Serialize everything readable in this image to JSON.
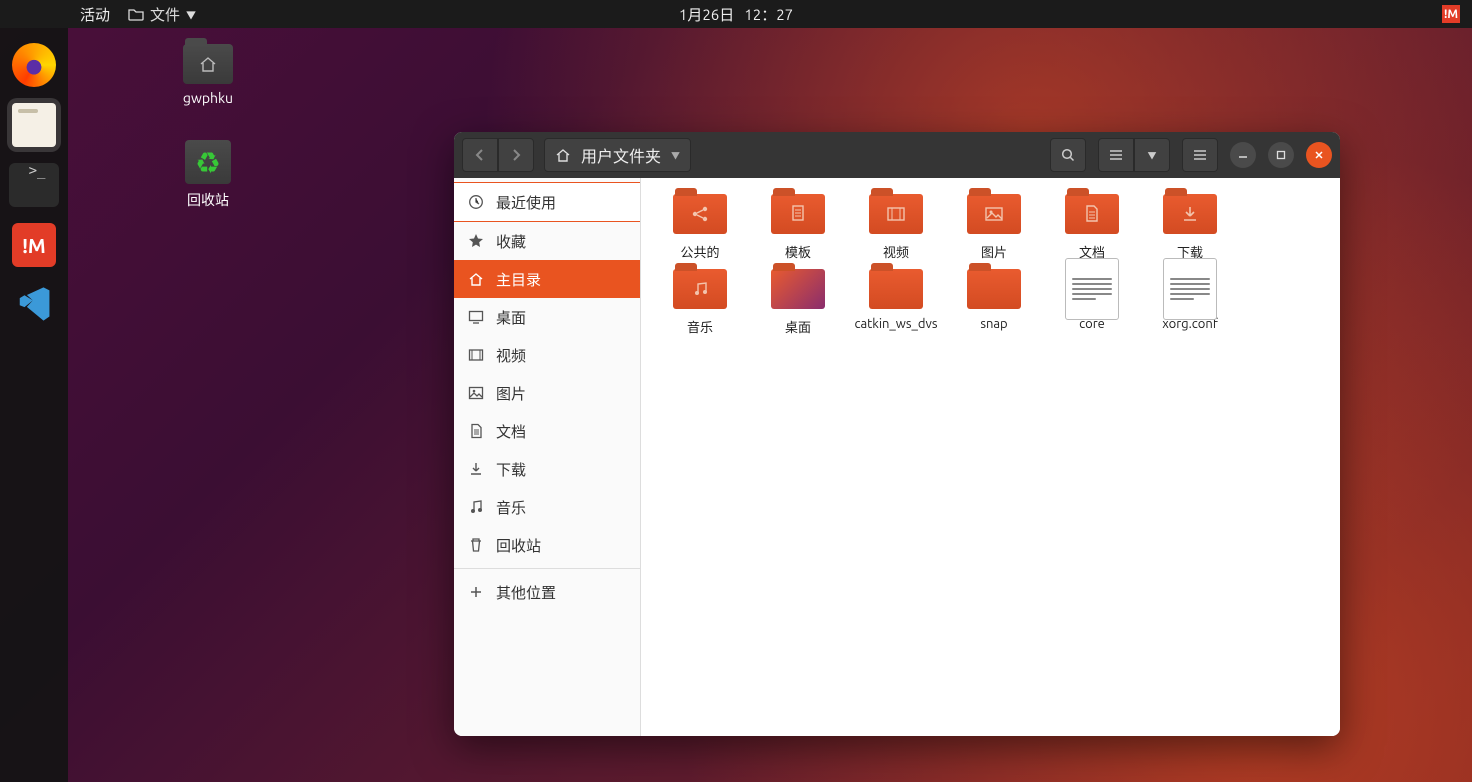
{
  "top": {
    "activities": "活动",
    "app_label": "文件",
    "date": "1月26日",
    "time": "12：27"
  },
  "dock": {
    "items": [
      "firefox",
      "files",
      "terminal",
      "nomachine",
      "vscode"
    ]
  },
  "desktop": {
    "home_folder": "gwphku",
    "trash": "回收站"
  },
  "fm": {
    "path_label": "用户文件夹",
    "sidebar": {
      "recent": "最近使用",
      "starred": "收藏",
      "home": "主目录",
      "desktop": "桌面",
      "videos": "视频",
      "pictures": "图片",
      "documents": "文档",
      "downloads": "下载",
      "music": "音乐",
      "trash": "回收站",
      "other": "其他位置"
    },
    "content": [
      {
        "label": "公共的",
        "type": "share"
      },
      {
        "label": "模板",
        "type": "templates"
      },
      {
        "label": "视频",
        "type": "videos"
      },
      {
        "label": "图片",
        "type": "pictures"
      },
      {
        "label": "文档",
        "type": "documents"
      },
      {
        "label": "下载",
        "type": "downloads"
      },
      {
        "label": "音乐",
        "type": "music"
      },
      {
        "label": "桌面",
        "type": "desktop-gradient"
      },
      {
        "label": "catkin_ws_dvs",
        "type": "plain"
      },
      {
        "label": "snap",
        "type": "plain"
      },
      {
        "label": "core",
        "type": "textfile"
      },
      {
        "label": "xorg.conf",
        "type": "textfile"
      }
    ]
  }
}
